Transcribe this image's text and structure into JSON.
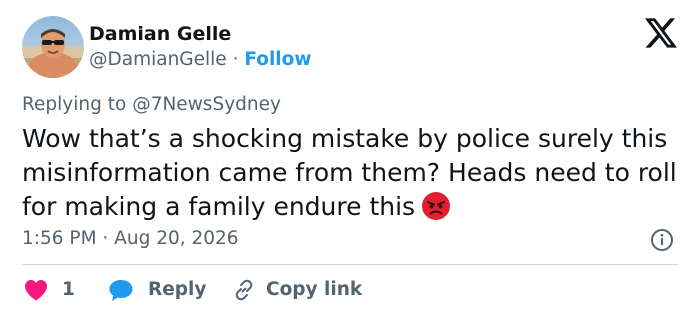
{
  "author": {
    "name": "Damian Gelle",
    "handle": "@DamianGelle",
    "separator": " · ",
    "follow_label": "Follow"
  },
  "reply_context": {
    "prefix": "Replying to ",
    "mention": "@7NewsSydney"
  },
  "tweet": {
    "text": "Wow that’s a shocking mistake by police surely this misinformation came from them? Heads need to roll for making a family endure this",
    "emoji": "angry-face-emoji",
    "timestamp": "1:56 PM · Aug 20, 2026"
  },
  "actions": {
    "like_count": "1",
    "reply_label": "Reply",
    "copy_label": "Copy link"
  },
  "colors": {
    "accent": "#1d9bf0",
    "like": "#f91880",
    "secondary_text": "#536471",
    "primary_text": "#0f1419",
    "angry_emoji": "#e0202e"
  },
  "icons": {
    "logo": "x-logo-icon",
    "info": "info-icon",
    "like": "heart-icon",
    "reply": "chat-bubble-icon",
    "copy": "link-icon"
  }
}
